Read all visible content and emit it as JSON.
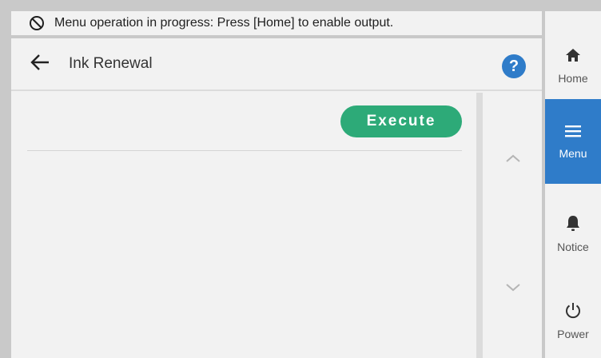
{
  "status_bar": {
    "icon": "prohibited-icon",
    "message": "Menu operation in progress: Press [Home] to enable output."
  },
  "header": {
    "title": "Ink Renewal",
    "back_icon": "arrow-left-icon",
    "help_label": "?"
  },
  "main": {
    "execute_label": "Execute"
  },
  "scroll": {
    "up_icon": "chevron-up-icon",
    "down_icon": "chevron-down-icon"
  },
  "nav": {
    "items": [
      {
        "label": "Home",
        "icon": "home-icon",
        "active": false
      },
      {
        "label": "Menu",
        "icon": "menu-icon",
        "active": true
      },
      {
        "label": "Notice",
        "icon": "bell-icon",
        "active": false
      },
      {
        "label": "Power",
        "icon": "power-icon",
        "active": false
      }
    ]
  },
  "colors": {
    "accent_blue": "#2f7cc9",
    "execute_green": "#2daa78",
    "panel_bg": "#f2f2f2",
    "frame_bg": "#c9c9c9"
  }
}
